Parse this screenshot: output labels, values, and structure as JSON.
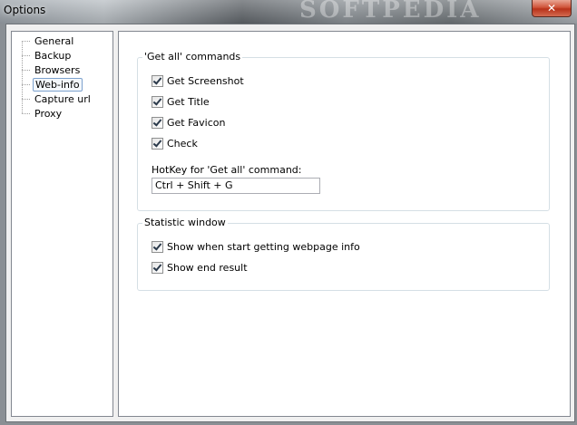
{
  "window": {
    "title": "Options",
    "watermark": "SOFTPEDIA",
    "close_glyph": "✕"
  },
  "tree": {
    "items": [
      {
        "label": "General",
        "selected": false
      },
      {
        "label": "Backup",
        "selected": false
      },
      {
        "label": "Browsers",
        "selected": false
      },
      {
        "label": "Web-info",
        "selected": true
      },
      {
        "label": "Capture url",
        "selected": false
      },
      {
        "label": "Proxy",
        "selected": false
      }
    ]
  },
  "get_all": {
    "title": "'Get all' commands",
    "checkboxes": [
      {
        "label": "Get Screenshot",
        "checked": true
      },
      {
        "label": "Get Title",
        "checked": true
      },
      {
        "label": "Get Favicon",
        "checked": true
      },
      {
        "label": "Check",
        "checked": true
      }
    ],
    "hotkey_label": "HotKey for 'Get all' command:",
    "hotkey_value": "Ctrl + Shift + G"
  },
  "statistic": {
    "title": "Statistic window",
    "checkboxes": [
      {
        "label": "Show when start getting webpage info",
        "checked": true
      },
      {
        "label": "Show end result",
        "checked": true
      }
    ]
  }
}
